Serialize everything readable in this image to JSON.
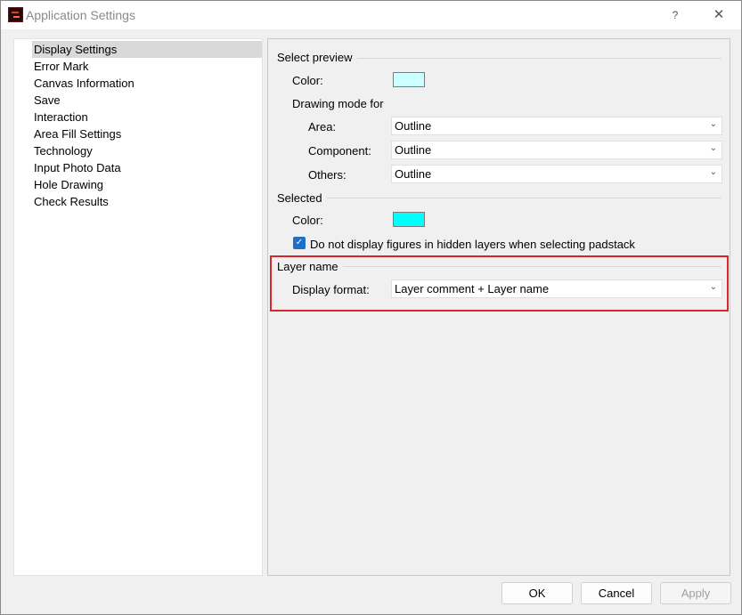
{
  "window": {
    "title": "Application Settings",
    "help_label": "?",
    "close_label": "✕"
  },
  "nav": {
    "items": [
      {
        "label": "Display Settings",
        "selected": true
      },
      {
        "label": "Error Mark"
      },
      {
        "label": "Canvas Information"
      },
      {
        "label": "Save"
      },
      {
        "label": "Interaction"
      },
      {
        "label": "Area Fill Settings"
      },
      {
        "label": "Technology"
      },
      {
        "label": "Input Photo Data"
      },
      {
        "label": "Hole Drawing"
      },
      {
        "label": "Check Results"
      }
    ]
  },
  "select_preview": {
    "group_title": "Select preview",
    "color_label": "Color:",
    "color_value": "#ccffff",
    "drawing_mode_label": "Drawing mode for",
    "area_label": "Area:",
    "area_value": "Outline",
    "component_label": "Component:",
    "component_value": "Outline",
    "others_label": "Others:",
    "others_value": "Outline"
  },
  "selected": {
    "group_title": "Selected",
    "color_label": "Color:",
    "color_value": "#00ffff",
    "checkbox_label": "Do not display figures in hidden layers when selecting padstack",
    "checkbox_checked": true
  },
  "layer_name": {
    "group_title": "Layer name",
    "display_format_label": "Display format:",
    "display_format_value": "Layer comment + Layer name"
  },
  "footer": {
    "ok_label": "OK",
    "cancel_label": "Cancel",
    "apply_label": "Apply"
  },
  "colors": {
    "highlight_border": "#d9262c",
    "checkbox_accent": "#1f6fc4"
  },
  "icons": {
    "dropdown": "chevron-down-icon",
    "check": "checkmark-icon"
  }
}
